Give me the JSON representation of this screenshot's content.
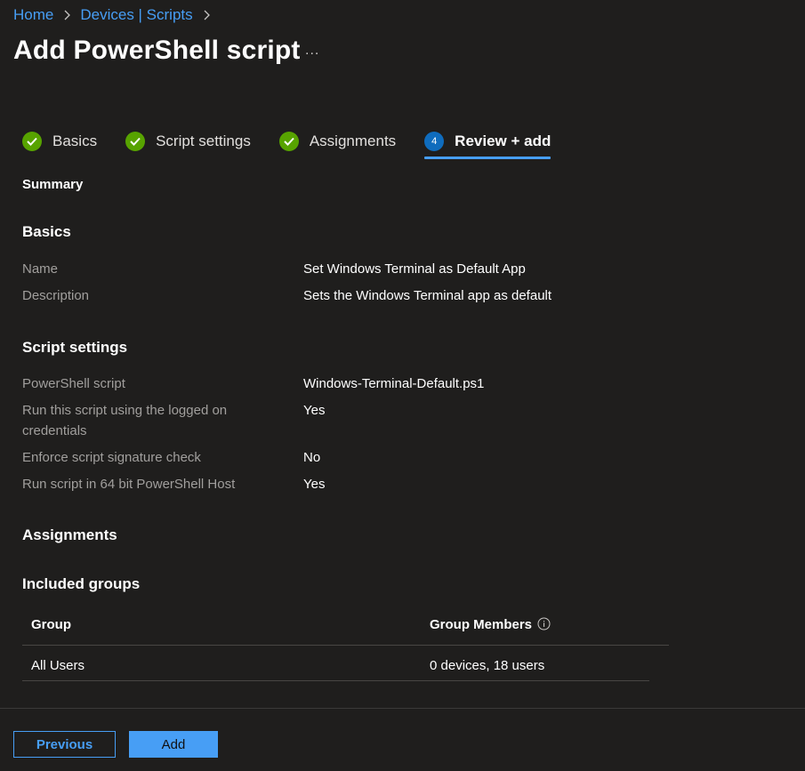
{
  "breadcrumb": {
    "home": "Home",
    "devices_scripts": "Devices | Scripts"
  },
  "page": {
    "title": "Add PowerShell script",
    "more": "..."
  },
  "wizard": {
    "steps": [
      {
        "label": "Basics",
        "state": "complete",
        "icon": "checkmark-icon"
      },
      {
        "label": "Script settings",
        "state": "complete",
        "icon": "checkmark-icon"
      },
      {
        "label": "Assignments",
        "state": "complete",
        "icon": "checkmark-icon"
      },
      {
        "label": "Review + add",
        "state": "active",
        "number": "4"
      }
    ]
  },
  "summary": {
    "heading": "Summary",
    "basics": {
      "heading": "Basics",
      "rows": [
        {
          "label": "Name",
          "value": "Set Windows Terminal as Default App"
        },
        {
          "label": "Description",
          "value": "Sets the Windows Terminal app as default"
        }
      ]
    },
    "script_settings": {
      "heading": "Script settings",
      "rows": [
        {
          "label": "PowerShell script",
          "value": "Windows-Terminal-Default.ps1"
        },
        {
          "label": "Run this script using the logged on credentials",
          "value": "Yes"
        },
        {
          "label": "Enforce script signature check",
          "value": "No"
        },
        {
          "label": "Run script in 64 bit PowerShell Host",
          "value": "Yes"
        }
      ]
    },
    "assignments": {
      "heading": "Assignments",
      "included_groups": {
        "heading": "Included groups",
        "columns": [
          "Group",
          "Group Members"
        ],
        "rows": [
          {
            "group": "All Users",
            "members": "0 devices, 18 users"
          }
        ]
      }
    }
  },
  "footer": {
    "previous_label": "Previous",
    "add_label": "Add"
  },
  "colors": {
    "background": "#1f1e1d",
    "link": "#479ef5",
    "success": "#57a300",
    "step_active": "#0f6cbd",
    "label_muted": "#a19f9d"
  }
}
